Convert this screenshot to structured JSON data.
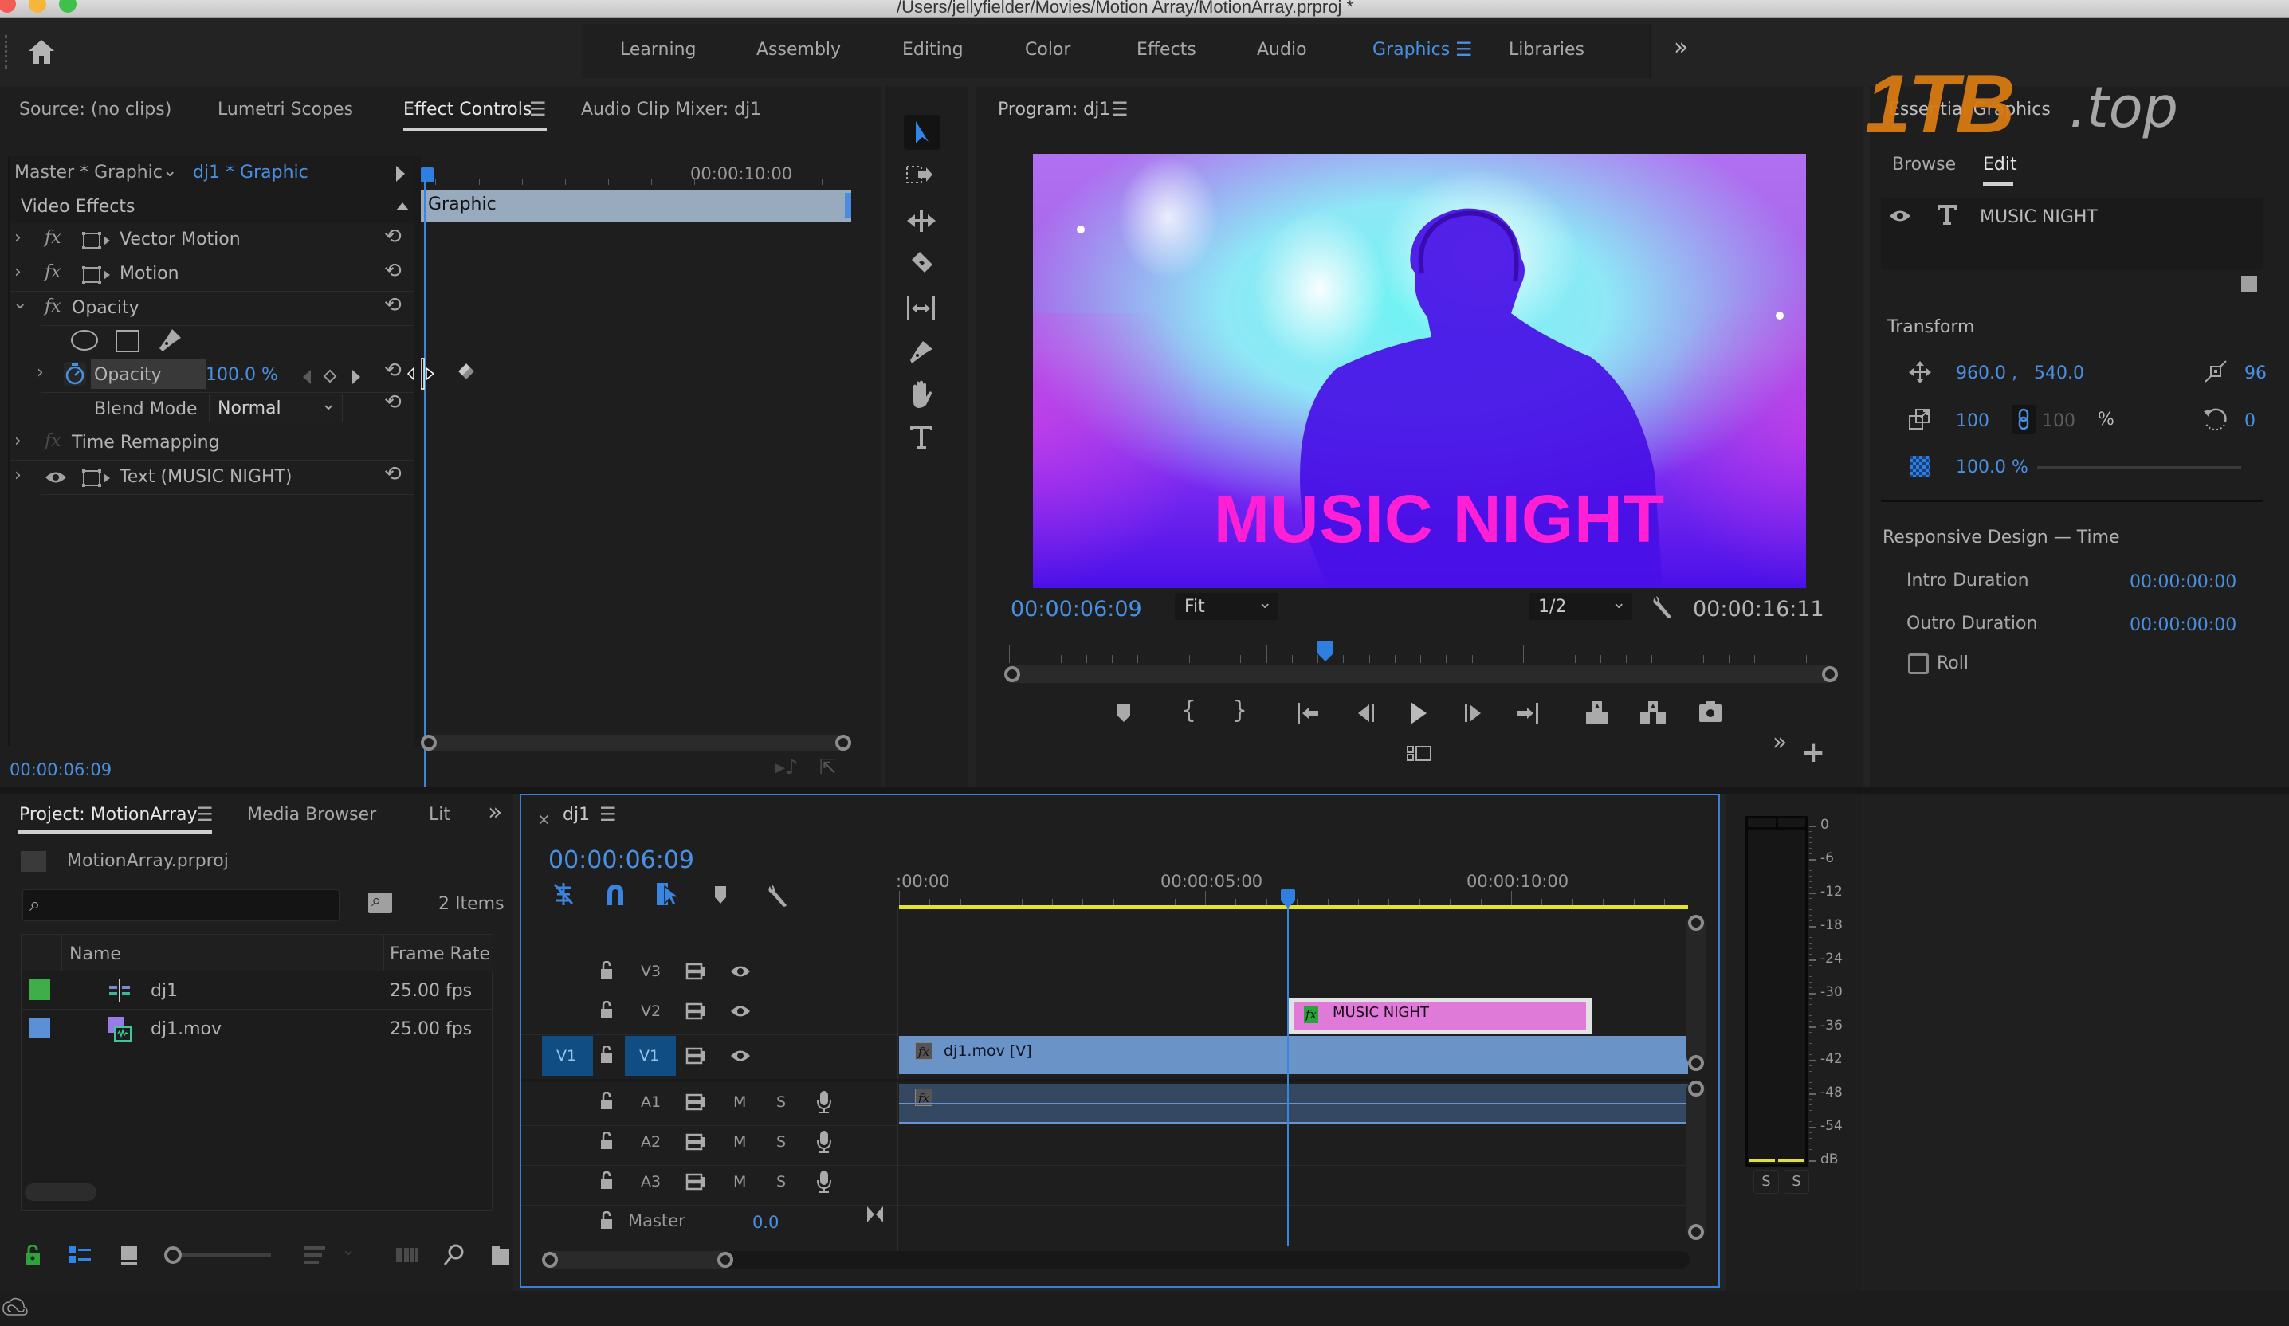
{
  "window": {
    "title": "/Users/jellyfielder/Movies/Motion Array/MotionArray.prproj *"
  },
  "workspaces": {
    "items": [
      "Learning",
      "Assembly",
      "Editing",
      "Color",
      "Effects",
      "Audio",
      "Graphics",
      "Libraries"
    ],
    "active": "Graphics",
    "overflow_label": "»"
  },
  "watermark": {
    "brand": "1TB",
    "suffix": ".top"
  },
  "upper_left": {
    "tabs": [
      "Source: (no clips)",
      "Lumetri Scopes",
      "Effect Controls",
      "Audio Clip Mixer: dj1"
    ],
    "active_tab": "Effect Controls"
  },
  "effect_controls": {
    "master_label": "Master * Graphic",
    "clip_label": "dj1 * Graphic",
    "ruler_time": "00:00:10:00",
    "clip_bar_label": "Graphic",
    "section_label": "Video Effects",
    "effects": [
      {
        "name": "Vector Motion",
        "fx": true,
        "transform_icon": true
      },
      {
        "name": "Motion",
        "fx": true,
        "transform_icon": true
      },
      {
        "name": "Opacity",
        "fx": true,
        "expanded": true
      },
      {
        "name": "Time Remapping",
        "fx": true,
        "disabled": true
      },
      {
        "name": "Text (MUSIC NIGHT)",
        "eye": true,
        "transform_icon": true
      }
    ],
    "opacity_param": {
      "label": "Opacity",
      "value": "100.0 %"
    },
    "blend_mode": {
      "label": "Blend Mode",
      "value": "Normal"
    },
    "current_time": "00:00:06:09"
  },
  "program_monitor": {
    "title": "Program: dj1",
    "overlay_text": "MUSIC NIGHT",
    "current_time": "00:00:06:09",
    "zoom": "Fit",
    "resolution": "1/2",
    "duration": "00:00:16:11",
    "playhead_fraction": 0.385
  },
  "essential_graphics": {
    "title": "Essential Graphics",
    "tabs": [
      "Browse",
      "Edit"
    ],
    "active_tab": "Edit",
    "layer_name": "MUSIC NIGHT",
    "transform_label": "Transform",
    "position_x": "960.0 ,",
    "position_y": "540.0",
    "anchor_value": "96",
    "scale": "100",
    "scale_linked": "100",
    "scale_unit": "%",
    "rotation": "0",
    "opacity": "100.0 %",
    "opacity_fraction": 1.0,
    "responsive_label": "Responsive Design — Time",
    "intro_label": "Intro Duration",
    "intro_value": "00:00:00:00",
    "outro_label": "Outro Duration",
    "outro_value": "00:00:00:00",
    "roll_label": "Roll",
    "roll_checked": false
  },
  "project": {
    "tabs": [
      "Project: MotionArray",
      "Media Browser",
      "Lit"
    ],
    "active_tab": "Project: MotionArray",
    "overflow_label": "»",
    "file": "MotionArray.prproj",
    "search_placeholder": "",
    "items_count": "2 Items",
    "columns": [
      "Name",
      "Frame Rate"
    ],
    "rows": [
      {
        "label_color": "#3fae49",
        "name": "dj1",
        "type": "sequence",
        "frame_rate": "25.00 fps"
      },
      {
        "label_color": "#5b8fd6",
        "name": "dj1.mov",
        "type": "clip",
        "frame_rate": "25.00 fps"
      }
    ]
  },
  "timeline": {
    "sequence_name": "dj1",
    "current_time": "00:00:06:09",
    "ruler_labels": [
      ":00:00",
      "00:00:05:00",
      "00:00:10:00"
    ],
    "video_tracks": [
      {
        "name": "V3"
      },
      {
        "name": "V2"
      },
      {
        "name": "V1",
        "source_patch": "V1",
        "targeted": true
      }
    ],
    "audio_tracks": [
      {
        "name": "A1",
        "mute": "M",
        "solo": "S"
      },
      {
        "name": "A2",
        "mute": "M",
        "solo": "S"
      },
      {
        "name": "A3",
        "mute": "M",
        "solo": "S"
      }
    ],
    "master": {
      "label": "Master",
      "value": "0.0"
    },
    "clips": [
      {
        "track": "V2",
        "label": "MUSIC NIGHT",
        "color": "#e07ad8"
      },
      {
        "track": "V1",
        "label": "dj1.mov [V]",
        "color": "#6a93c8"
      },
      {
        "track": "A1",
        "label": "",
        "color": "#344862"
      }
    ]
  },
  "audio_meter": {
    "scale": [
      "0",
      "-6",
      "-12",
      "-18",
      "-24",
      "-30",
      "-36",
      "-42",
      "-48",
      "-54",
      "dB"
    ],
    "solo_labels": [
      "S",
      "S"
    ]
  },
  "colors": {
    "accent": "#4a90e2",
    "playhead": "#2f7fe0",
    "work_area": "#e6e12a",
    "title_text": "#ff1fd4"
  }
}
